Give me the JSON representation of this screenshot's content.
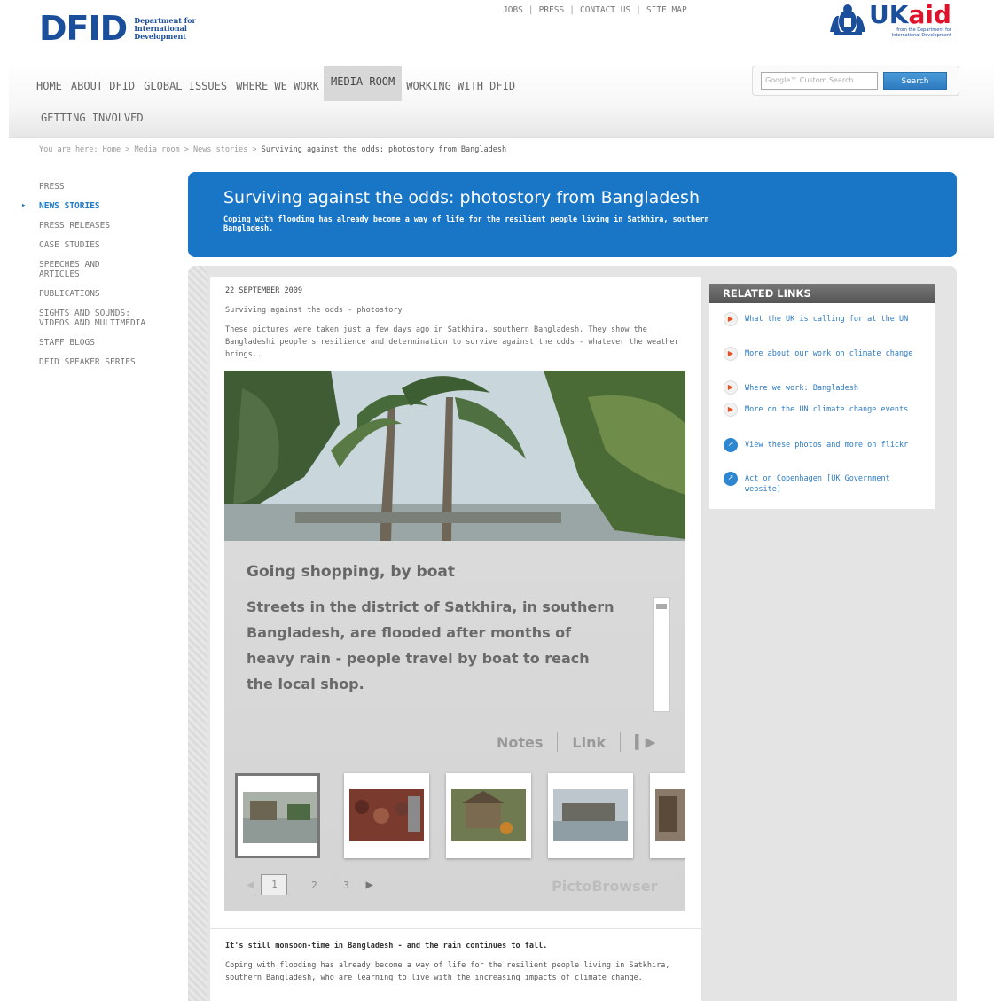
{
  "header": {
    "logo_word": "DFID",
    "logo_sub": [
      "Department for",
      "International",
      "Development"
    ],
    "ukaid_uk": "UK",
    "ukaid_aid": "aid",
    "ukaid_small": [
      "from the Department for",
      "International Development"
    ],
    "utility_links": [
      "JOBS",
      "PRESS",
      "CONTACT US",
      "SITE MAP"
    ]
  },
  "nav": {
    "items": [
      "HOME",
      "ABOUT DFID",
      "GLOBAL ISSUES",
      "WHERE WE WORK",
      "MEDIA ROOM",
      "WORKING WITH DFID"
    ],
    "row2": "GETTING INVOLVED",
    "active": "MEDIA ROOM"
  },
  "search": {
    "placeholder": "Google™ Custom Search",
    "button": "Search"
  },
  "breadcrumb": {
    "prefix": "You are here: Home > Media room > News stories > ",
    "current": "Surviving against the odds: photostory from Bangladesh"
  },
  "sidebar": {
    "items": [
      "PRESS",
      "NEWS STORIES",
      "PRESS RELEASES",
      "CASE STUDIES",
      "SPEECHES AND ARTICLES",
      "PUBLICATIONS",
      "SIGHTS AND SOUNDS: VIDEOS AND MULTIMEDIA",
      "STAFF BLOGS",
      "DFID SPEAKER SERIES"
    ],
    "active": "NEWS STORIES"
  },
  "banner": {
    "title": "Surviving against the odds: photostory from Bangladesh",
    "subtitle": "Coping with flooding has already become a way of life for the resilient people living in Satkhira, southern Bangladesh."
  },
  "article": {
    "date": "22 SEPTEMBER 2009",
    "kicker": "Surviving against the odds - photostory",
    "intro": "These pictures were taken just a few days ago in Satkhira, southern Bangladesh. They show the Bangladeshi people's resilience and determination to survive against the odds - whatever the weather brings..",
    "lead": "It's still monsoon-time in Bangladesh - and the rain continues to fall.",
    "body": "Coping with flooding has already become a way of life for the resilient people living in Satkhira, southern Bangladesh, who are learning to live with the increasing impacts of climate change."
  },
  "viewer": {
    "caption_title": "Going shopping, by boat",
    "caption_text": "Streets in the district of Satkhira, in southern Bangladesh, are flooded after months of heavy rain - people travel by boat to reach the local shop.",
    "notes": "Notes",
    "link": "Link",
    "pages": [
      "1",
      "2",
      "3"
    ],
    "brand": "PictoBrowser"
  },
  "related": {
    "heading": "RELATED LINKS",
    "links": [
      {
        "text": "What the UK is calling for at the UN",
        "icon": "arrow-icon"
      },
      {
        "text": "More about our work on climate change",
        "icon": "arrow-icon"
      },
      {
        "text": "Where we work: Bangladesh",
        "icon": "arrow-icon"
      },
      {
        "text": "More on the UN climate change events",
        "icon": "arrow-icon"
      },
      {
        "text": "View these photos and more on flickr",
        "icon": "external-link-icon"
      },
      {
        "text": "Act on Copenhagen [UK Government website]",
        "icon": "external-link-icon"
      }
    ]
  },
  "colors": {
    "brand_blue": "#1975c6",
    "link_blue": "#2c7bc4",
    "ukaid_red": "#e0112b"
  }
}
